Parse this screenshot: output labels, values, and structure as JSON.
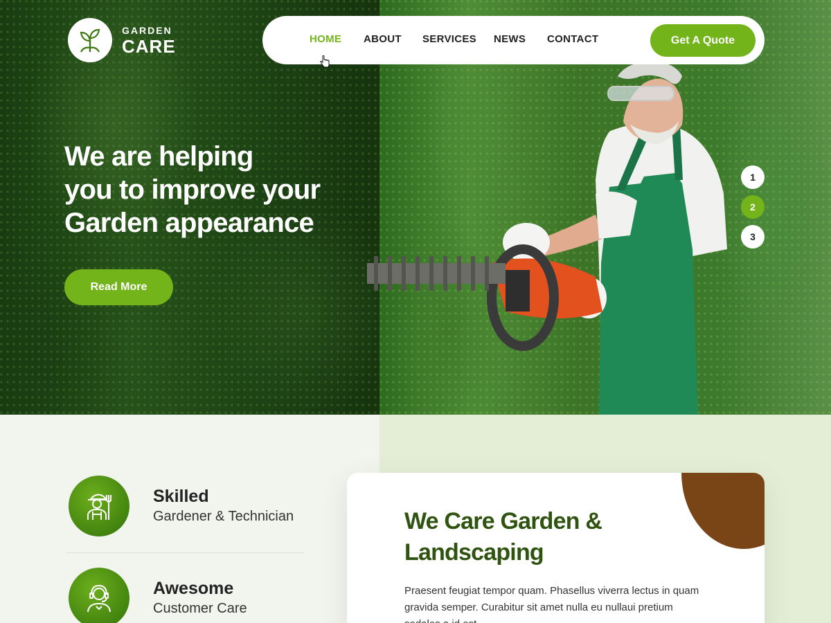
{
  "brand": {
    "line1": "GARDEN",
    "line2": "CARE",
    "icon": "plant-sprout-icon"
  },
  "nav": {
    "items": [
      {
        "label": "HOME",
        "active": true
      },
      {
        "label": "ABOUT",
        "active": false
      },
      {
        "label": "SERVICES",
        "active": false
      },
      {
        "label": "NEWS",
        "active": false
      },
      {
        "label": "CONTACT",
        "active": false
      }
    ],
    "cta_label": "Get A Quote"
  },
  "hero": {
    "title_lines": [
      "We are helping",
      "you to improve your",
      "Garden appearance"
    ],
    "button_label": "Read More",
    "slides": [
      "1",
      "2",
      "3"
    ],
    "active_slide": "2"
  },
  "features": [
    {
      "title": "Skilled",
      "subtitle": "Gardener & Technician",
      "icon": "gardener-icon"
    },
    {
      "title": "Awesome",
      "subtitle": "Customer Care",
      "icon": "support-agent-icon"
    }
  ],
  "about_card": {
    "title_lines": [
      "We Care Garden &",
      "Landscaping"
    ],
    "body": "Praesent feugiat tempor quam. Phasellus viverra lectus in quam gravida semper. Curabitur sit amet nulla eu nullaui pretium sodales a id est."
  },
  "colors": {
    "accent": "#72b419",
    "dark_green": "#2f5410",
    "brown": "#7a4516",
    "light_green_bg": "#e4eed6"
  }
}
